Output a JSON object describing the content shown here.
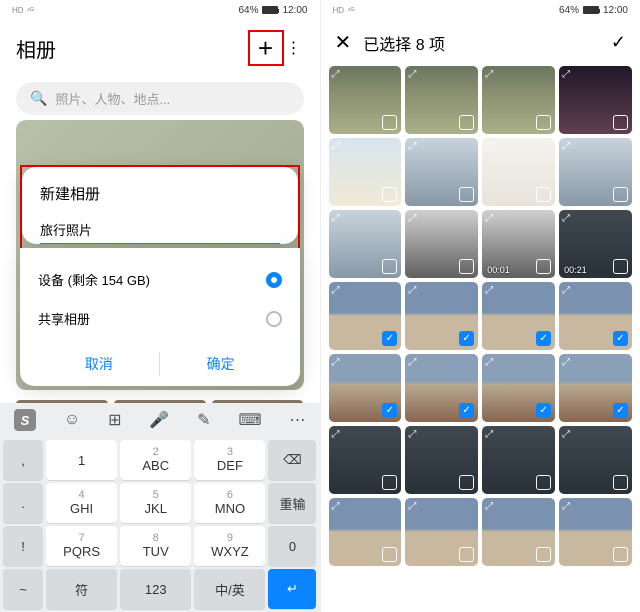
{
  "status": {
    "battery_pct": "64%",
    "time": "12:00"
  },
  "left": {
    "title": "相册",
    "search_placeholder": "照片、人物、地点...",
    "dialog": {
      "title": "新建相册",
      "input_value": "旅行照片",
      "opt_device": "设备 (剩余 154 GB)",
      "opt_shared": "共享相册",
      "cancel": "取消",
      "confirm": "确定"
    },
    "keyboard": {
      "rows": [
        [
          ",",
          "1",
          "ABC",
          "DEF",
          "⌫"
        ],
        [
          ".",
          "GHI",
          "JKL",
          "MNO",
          "重输"
        ],
        [
          "!",
          "PQRS",
          "TUV",
          "WXYZ",
          "0"
        ],
        [
          "~",
          "符",
          "123",
          "中/英",
          "↵"
        ]
      ],
      "nums": [
        "2",
        "3",
        "4",
        "5",
        "6",
        "7",
        "8",
        "9"
      ]
    }
  },
  "right": {
    "title": "已选择 8 项",
    "photos": [
      {
        "theme": "p-city",
        "checked": false,
        "dur": null
      },
      {
        "theme": "p-city",
        "checked": false,
        "dur": null
      },
      {
        "theme": "p-city",
        "checked": false,
        "dur": null
      },
      {
        "theme": "p-night",
        "checked": false,
        "dur": null
      },
      {
        "theme": "p-sky",
        "checked": false,
        "dur": null
      },
      {
        "theme": "p-bldg",
        "checked": false,
        "dur": null
      },
      {
        "theme": "p-white",
        "checked": false,
        "dur": null
      },
      {
        "theme": "p-bldg",
        "checked": false,
        "dur": null
      },
      {
        "theme": "p-bldg",
        "checked": false,
        "dur": null
      },
      {
        "theme": "p-car",
        "checked": false,
        "dur": null
      },
      {
        "theme": "p-car",
        "checked": false,
        "dur": "00:01"
      },
      {
        "theme": "p-dark",
        "checked": false,
        "dur": "00:21"
      },
      {
        "theme": "p-mtn",
        "checked": true,
        "dur": null
      },
      {
        "theme": "p-mtn",
        "checked": true,
        "dur": null
      },
      {
        "theme": "p-mtn",
        "checked": true,
        "dur": null
      },
      {
        "theme": "p-mtn",
        "checked": true,
        "dur": null
      },
      {
        "theme": "p-mtn2",
        "checked": true,
        "dur": null
      },
      {
        "theme": "p-mtn2",
        "checked": true,
        "dur": null
      },
      {
        "theme": "p-mtn2",
        "checked": true,
        "dur": null
      },
      {
        "theme": "p-mtn2",
        "checked": true,
        "dur": null
      },
      {
        "theme": "p-dark",
        "checked": false,
        "dur": null
      },
      {
        "theme": "p-dark",
        "checked": false,
        "dur": null
      },
      {
        "theme": "p-dark",
        "checked": false,
        "dur": null
      },
      {
        "theme": "p-dark",
        "checked": false,
        "dur": null
      },
      {
        "theme": "p-mtn",
        "checked": false,
        "dur": null
      },
      {
        "theme": "p-mtn",
        "checked": false,
        "dur": null
      },
      {
        "theme": "p-mtn",
        "checked": false,
        "dur": null
      },
      {
        "theme": "p-mtn",
        "checked": false,
        "dur": null
      }
    ]
  }
}
